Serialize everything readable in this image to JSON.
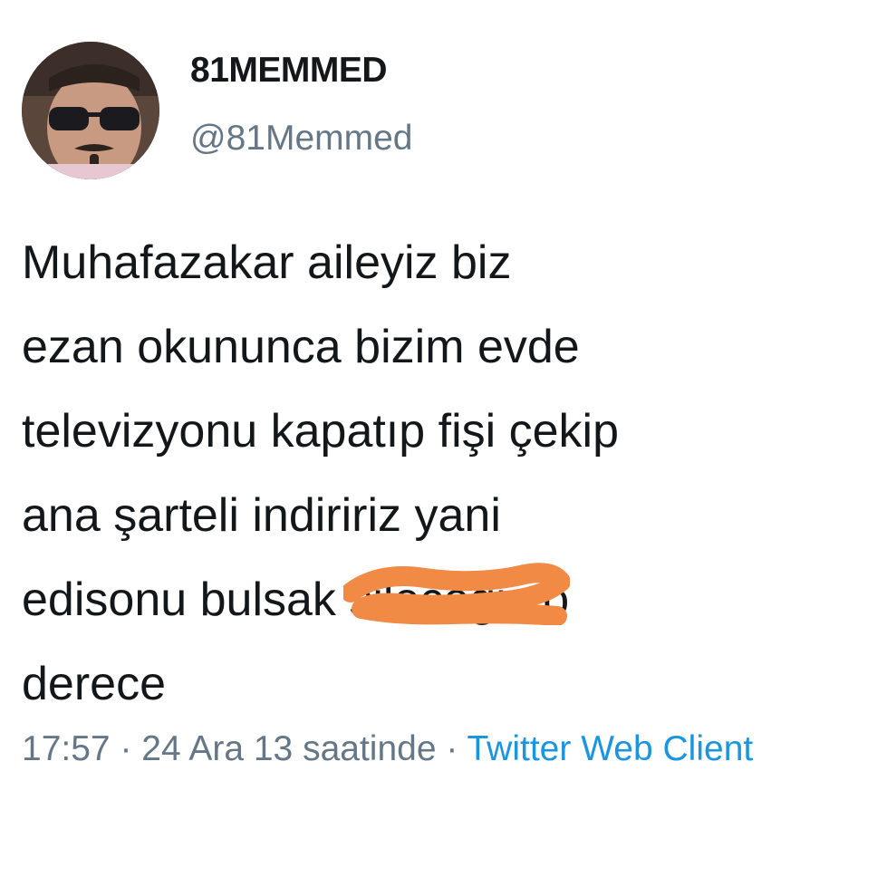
{
  "user": {
    "display_name": "81MEMMED",
    "handle": "@81Memmed",
    "avatar": "profile-photo-man-sunglasses"
  },
  "tweet": {
    "lines": [
      "Muhafazakar aileyiz biz",
      "ezan okununca bizim evde",
      "televizyonu kapatıp fişi çekip",
      "ana şarteli indiririz yani",
      "edisonu bulsak ",
      "derece"
    ],
    "redacted_word": "sileceğiz",
    "after_redaction": " o",
    "scribble_color": "#f08a45"
  },
  "meta": {
    "time": "17:57",
    "separator": " · ",
    "date": "24 Ara 13 saatinde",
    "source": "Twitter Web Client"
  },
  "colors": {
    "text": "#14171a",
    "secondary": "#657786",
    "link": "#1b95e0"
  }
}
